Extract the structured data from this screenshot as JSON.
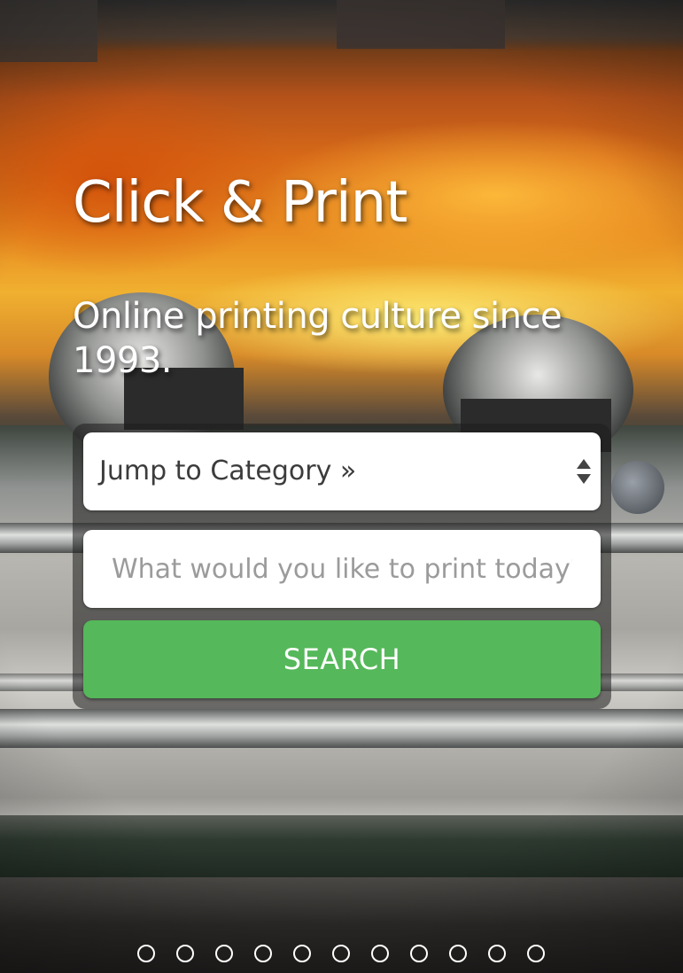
{
  "hero": {
    "title": "Click & Print",
    "subtitle": "Online printing culture since 1993."
  },
  "search_panel": {
    "category_select_value": "Jump to Category »",
    "search_placeholder": "What would you like to print today?",
    "search_button_label": "SEARCH",
    "button_color": "#55b85a"
  },
  "carousel": {
    "slide_count": 11
  }
}
